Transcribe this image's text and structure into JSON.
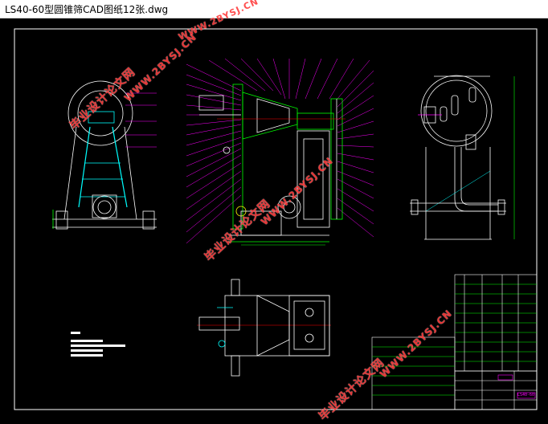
{
  "window": {
    "title": "LS40-60型圆锥筛CAD图纸12张.dwg"
  },
  "colors": {
    "background": "#000000",
    "line_white": "#ffffff",
    "line_green": "#00ff00",
    "line_magenta": "#ff00ff",
    "line_cyan": "#00ffff",
    "line_yellow": "#ffff00",
    "watermark": "#ff3b3b"
  },
  "watermarks": [
    {
      "text": "毕业设计论文网",
      "kind": "cn"
    },
    {
      "text": "WWW.2BYSJ.CN",
      "kind": "url"
    },
    {
      "text": "毕业设计论文网",
      "kind": "cn"
    },
    {
      "text": "WWW.2BYSJ.CN",
      "kind": "url"
    },
    {
      "text": "毕业设计论文网",
      "kind": "cn"
    },
    {
      "text": "WWW.2BYSJ.CN",
      "kind": "url"
    },
    {
      "text": "毕业设计论文网",
      "kind": "cn"
    },
    {
      "text": "WWW.2BYSJ.CN",
      "kind": "url"
    }
  ],
  "title_block": {
    "drawing_no": "LS40-60"
  }
}
